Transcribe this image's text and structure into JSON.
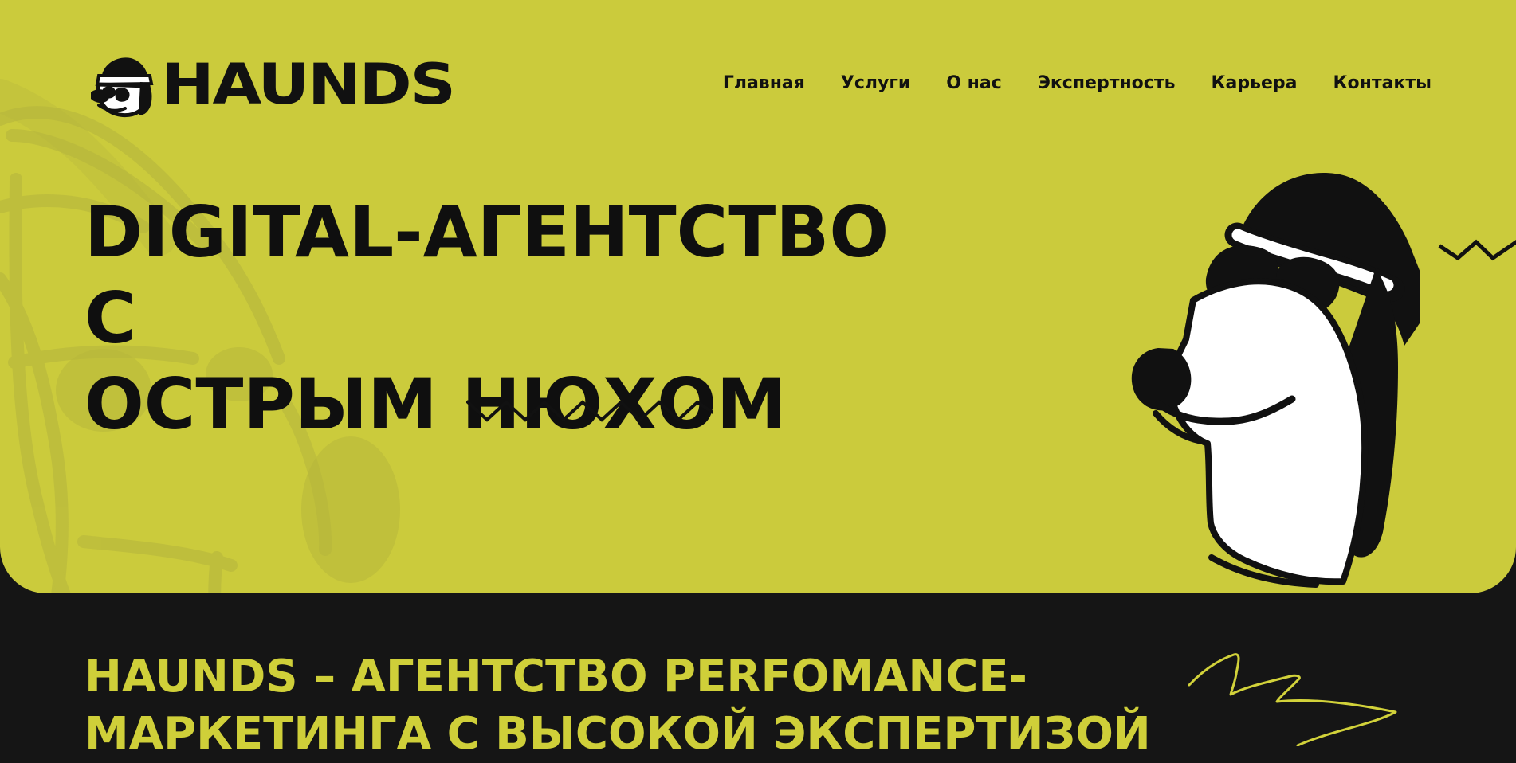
{
  "brand": {
    "name": "HAUNDS"
  },
  "nav": {
    "items": [
      "Главная",
      "Услуги",
      "О нас",
      "Экспертность",
      "Карьера",
      "Контакты"
    ]
  },
  "hero": {
    "title_line_1": "DIGITAL-АГЕНТСТВО С",
    "title_line_2": "ОСТРЫМ НЮХОМ"
  },
  "about": {
    "title_line_1": "HAUNDS – АГЕНТСТВО PERFOMANCE-",
    "title_line_2": "МАРКЕТИНГА С ВЫСОКОЙ ЭКСПЕРТИЗОЙ"
  },
  "colors": {
    "hero_background": "#cbcb3c",
    "page_background": "#151515",
    "text_dark": "#111111",
    "text_accent": "#cfcf39"
  },
  "icons": {
    "logo": "dog-in-beanie-logo",
    "decor_1": "zigzag-line-icon",
    "decor_2": "scribble-line-icon",
    "illustration": "dog-with-sunglasses-illustration"
  }
}
